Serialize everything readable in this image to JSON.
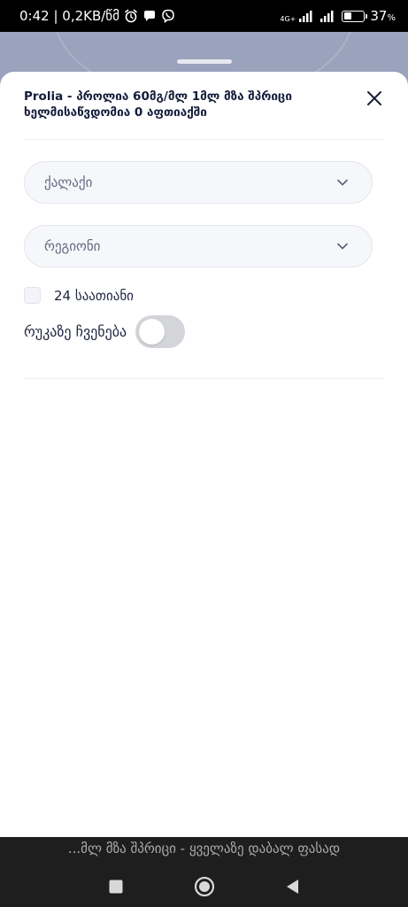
{
  "status_bar": {
    "time_and_speed": "0:42 | 0,2KB/წმ",
    "network_type": "4G+",
    "battery_percent": "37",
    "battery_unit": "%",
    "battery_level": 0.37
  },
  "sheet": {
    "title": "Prolia - პროლია 60მგ/მლ 1მლ მზა შპრიცი ხელმისაწვდომია 0 აფთიაქში",
    "close_icon": "close-icon"
  },
  "filters": {
    "city": {
      "value": "ქალაქი",
      "icon": "chevron-down-icon"
    },
    "region": {
      "value": "რეგიონი",
      "icon": "chevron-down-icon"
    },
    "open_24h": {
      "label": "24 საათიანი",
      "checked": false
    },
    "show_on_map": {
      "label": "რუკაზე ჩვენება",
      "enabled": false
    }
  },
  "bottom": {
    "ticker_text": "...მლ მზა შპრიცი - ყველაზე დაბალ ფასად",
    "nav": [
      "recent-apps-icon",
      "home-icon",
      "back-icon"
    ]
  },
  "colors": {
    "backdrop": "#9aa2bc",
    "title": "#141c3a",
    "select_bg": "#f6f7fa",
    "toggle_off": "#d3d5d9"
  }
}
